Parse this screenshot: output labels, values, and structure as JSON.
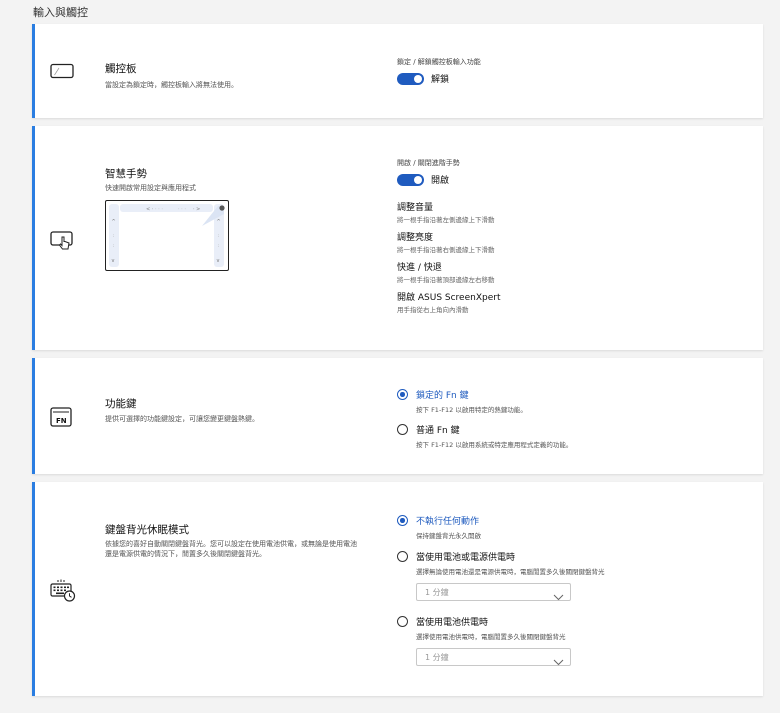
{
  "section_title": "輸入與觸控",
  "touchpad": {
    "title": "觸控板",
    "desc": "當設定為鎖定時，觸控板輸入將無法使用。",
    "toggle_caption": "鎖定 / 解鎖觸控板輸入功能",
    "toggle_state": "解鎖",
    "icon": "touchpad-icon"
  },
  "gestures": {
    "title": "智慧手勢",
    "desc": "快速開啟常用設定與應用程式",
    "toggle_caption": "開啟 / 關閉進階手勢",
    "toggle_state": "開啟",
    "icon": "touch-gesture-icon",
    "features": [
      {
        "title": "調整音量",
        "desc": "將一根手指沿著左側邊緣上下滑動"
      },
      {
        "title": "調整亮度",
        "desc": "將一根手指沿著右側邊緣上下滑動"
      },
      {
        "title": "快進 / 快退",
        "desc": "將一根手指沿著頂部邊緣左右移動"
      },
      {
        "title": "開啟 ASUS ScreenXpert",
        "desc": "用手指從右上角向內滑動"
      }
    ]
  },
  "fnkey": {
    "title": "功能鍵",
    "desc": "提供可選擇的功能鍵設定，可讓您變更鍵盤熱鍵。",
    "icon": "fn-key-icon",
    "icon_text": "FN",
    "options": [
      {
        "label": "鎖定的 Fn 鍵",
        "desc": "按下 F1-F12 以啟用特定的熱鍵功能。",
        "selected": true
      },
      {
        "label": "普通 Fn 鍵",
        "desc": "按下 F1-F12 以啟用系統或特定應用程式定義的功能。",
        "selected": false
      }
    ]
  },
  "backlight": {
    "title": "鍵盤背光休眠模式",
    "desc_line1": "依據您的喜好自動關閉鍵盤背光。您可以設定在使用電池供電，或無論是使用電池",
    "desc_line2": "還是電源供電的情況下，閒置多久後關閉鍵盤背光。",
    "icon": "keyboard-timer-icon",
    "options": [
      {
        "label": "不執行任何動作",
        "desc": "保持鍵盤背光永久開啟",
        "selected": true
      },
      {
        "label": "當使用電池或電源供電時",
        "desc": "選擇無論使用電池還是電源供電時，電腦閒置多久後關閉鍵盤背光",
        "selected": false,
        "select_value": "1 分鐘"
      },
      {
        "label": "當使用電池供電時",
        "desc": "選擇使用電池供電時，電腦閒置多久後關閉鍵盤背光",
        "selected": false,
        "select_value": "1 分鐘"
      }
    ]
  },
  "colors": {
    "accent": "#1f5bbf",
    "card_border": "#2a7de1",
    "background": "#f3f3f3"
  }
}
